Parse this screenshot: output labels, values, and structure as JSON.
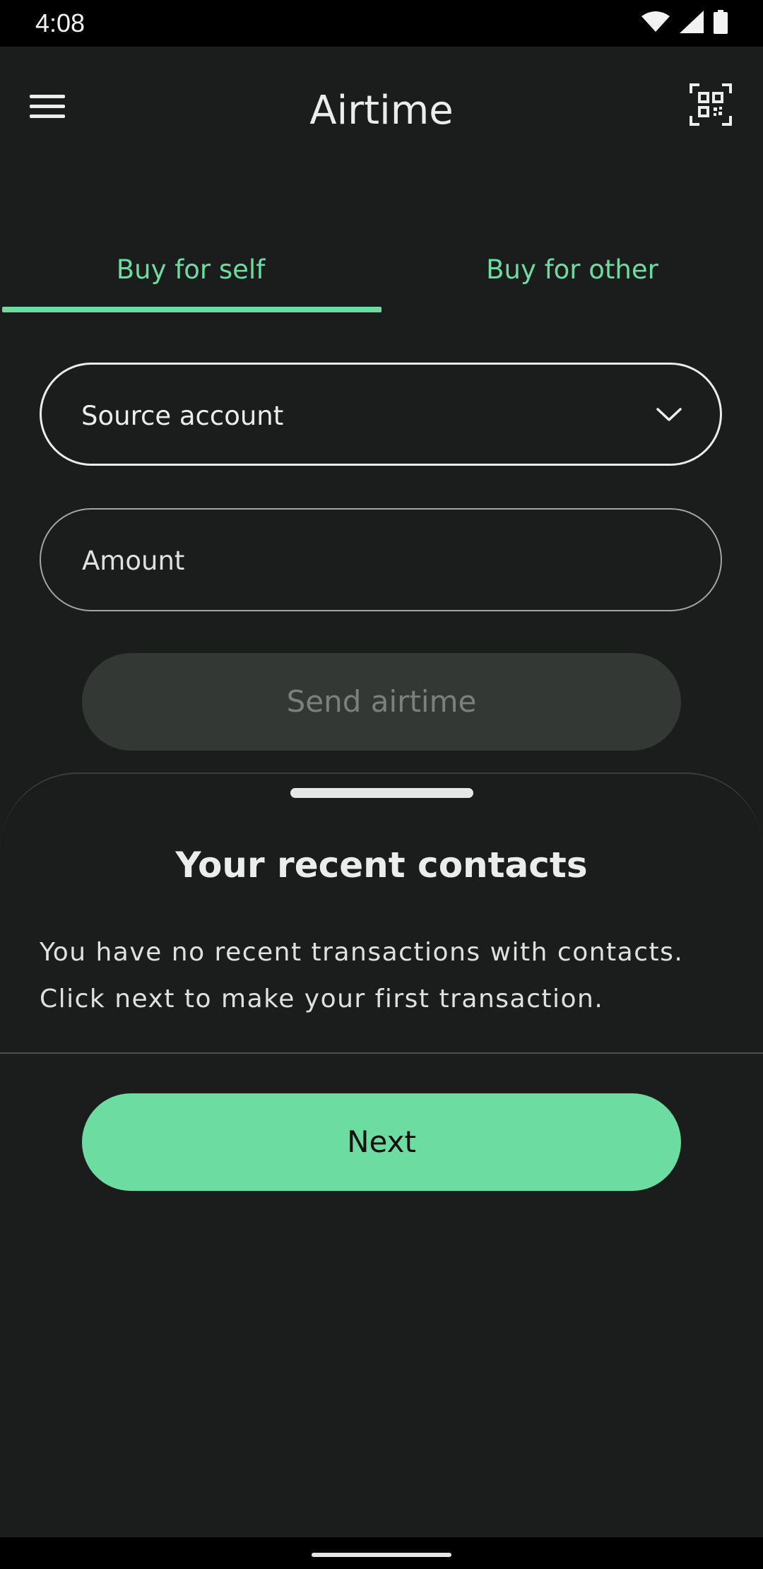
{
  "status_bar": {
    "time": "4:08",
    "icons": [
      "wifi-icon",
      "signal-icon",
      "battery-icon"
    ]
  },
  "app_bar": {
    "title": "Airtime",
    "menu_icon": "hamburger-menu-icon",
    "scan_icon": "qr-code-icon"
  },
  "tabs": [
    {
      "label": "Buy for self",
      "selected": true
    },
    {
      "label": "Buy for other",
      "selected": false
    }
  ],
  "form": {
    "source_account_label": "Source account",
    "amount_label": "Amount",
    "send_button": "Send airtime"
  },
  "recent_contacts": {
    "title": "Your recent contacts",
    "message": "You have no recent transactions with contacts. Click next to make your first transaction.",
    "next_button": "Next"
  },
  "colors": {
    "accent": "#6cdca0",
    "background": "#1b1d1c",
    "disabled_button": "#343835"
  }
}
